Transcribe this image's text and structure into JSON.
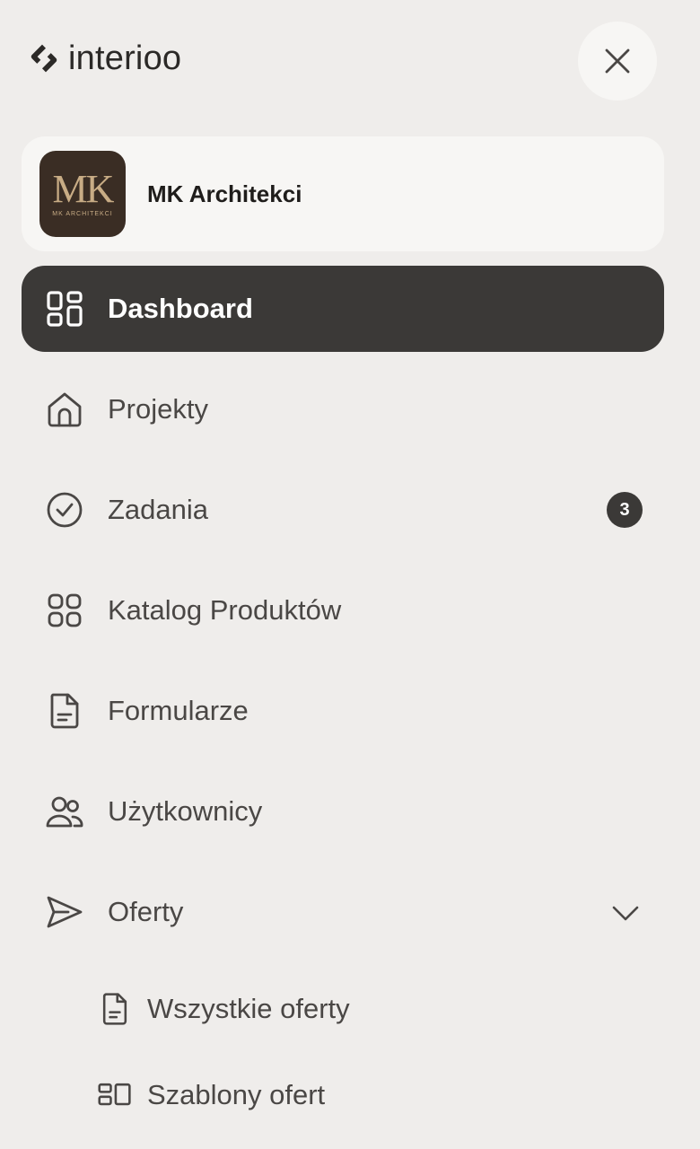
{
  "app": {
    "brand": "interioo"
  },
  "organization": {
    "name": "MK Architekci",
    "avatar_monogram": "MK",
    "avatar_subtext": "MK ARCHITEKCI"
  },
  "nav": {
    "dashboard": "Dashboard",
    "projects": "Projekty",
    "tasks": "Zadania",
    "tasks_badge": "3",
    "catalog": "Katalog Produktów",
    "forms": "Formularze",
    "users": "Użytkownicy",
    "offers": "Oferty",
    "offers_all": "Wszystkie oferty",
    "offers_templates": "Szablony ofert"
  },
  "colors": {
    "background": "#efedeb",
    "card": "#f7f6f4",
    "active": "#3b3937",
    "text": "#4a4745"
  }
}
